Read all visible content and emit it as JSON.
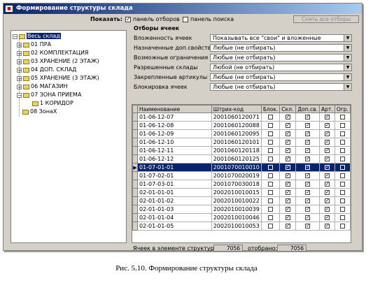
{
  "window": {
    "title": "Формирование структуры склада",
    "app_icon": "app-icon"
  },
  "toolbar": {
    "show_label": "Показать:",
    "filters_panel": {
      "label": "панель отборов",
      "checked": true
    },
    "search_panel": {
      "label": "панель поиска",
      "checked": false
    },
    "reset_button": "Снять все отборы"
  },
  "tree": {
    "root": "Весь склад",
    "items": [
      "01 ПРА",
      "02 КОМПЛЕКТАЦИЯ",
      "03 ХРАНЕНИЕ (2 ЭТАЖ)",
      "04 ДОП. СКЛАД",
      "05 ХРАНЕНИЕ (3 ЭТАЖ)",
      "06 МАГАЗИН",
      "07 ЗОНА ПРИЕМА"
    ],
    "subitem": "1 КОРИДОР",
    "last": "08 ЗонаХ"
  },
  "filters": {
    "title": "Отборы ячеек",
    "rows": [
      {
        "label": "Вложенность ячеек",
        "value": "Показывать все \"свои\" и вложенные"
      },
      {
        "label": "Назначенные доп.свойства",
        "value": "Любые (не отбирать)"
      },
      {
        "label": "Возможные ограничения",
        "value": "Любые (не отбирать)"
      },
      {
        "label": "Разрешенные склады",
        "value": "Любой (не отбирать)"
      },
      {
        "label": "Закрепленные артикулы",
        "value": "Любые (не отбирать)"
      },
      {
        "label": "Блокировка ячеек",
        "value": "Любые (не отбирать)"
      }
    ]
  },
  "grid": {
    "columns": [
      "Наименование",
      "Штрих-код",
      "Блок.",
      "Скл.",
      "Доп.св.",
      "Арт.",
      "Огр."
    ],
    "rows": [
      {
        "name": "01-06-12-07",
        "barcode": "2001060120071",
        "checks": [
          false,
          true,
          true,
          true,
          false
        ]
      },
      {
        "name": "01-06-12-08",
        "barcode": "2001060120088",
        "checks": [
          false,
          true,
          true,
          true,
          false
        ]
      },
      {
        "name": "01-06-12-09",
        "barcode": "2001060120095",
        "checks": [
          false,
          true,
          true,
          true,
          false
        ]
      },
      {
        "name": "01-06-12-10",
        "barcode": "2001060120101",
        "checks": [
          false,
          true,
          true,
          true,
          false
        ]
      },
      {
        "name": "01-06-12-11",
        "barcode": "2001060120118",
        "checks": [
          false,
          true,
          true,
          true,
          false
        ]
      },
      {
        "name": "01-06-12-12",
        "barcode": "2001060120125",
        "checks": [
          false,
          true,
          true,
          true,
          false
        ]
      },
      {
        "name": "01-07-01-01",
        "barcode": "2001070010010",
        "checks": [
          false,
          true,
          true,
          true,
          false
        ],
        "selected": true
      },
      {
        "name": "01-07-02-01",
        "barcode": "2001070020019",
        "checks": [
          false,
          true,
          true,
          true,
          false
        ]
      },
      {
        "name": "01-07-03-01",
        "barcode": "2001070030018",
        "checks": [
          false,
          true,
          true,
          true,
          false
        ]
      },
      {
        "name": "02-01-01-01",
        "barcode": "2002010010015",
        "checks": [
          false,
          true,
          true,
          true,
          false
        ]
      },
      {
        "name": "02-01-01-02",
        "barcode": "2002010010022",
        "checks": [
          false,
          true,
          true,
          true,
          false
        ]
      },
      {
        "name": "02-01-01-03",
        "barcode": "2002010010039",
        "checks": [
          false,
          true,
          true,
          true,
          false
        ]
      },
      {
        "name": "02-01-01-04",
        "barcode": "2002010010046",
        "checks": [
          false,
          true,
          true,
          true,
          false
        ]
      },
      {
        "name": "02-01-01-05",
        "barcode": "2002010010053",
        "checks": [
          false,
          true,
          true,
          true,
          false
        ]
      }
    ]
  },
  "status": {
    "cells_label": "Ячеек в элементе структуры:",
    "cells_value": "7056",
    "selected_label": "отобрано:",
    "selected_value": "7056"
  },
  "caption": "Рис. 5.10. Формирование структуры склада",
  "colors": {
    "title_start": "#0a246a",
    "title_end": "#a6caf0",
    "face": "#d4d0c8",
    "selection": "#0a246a"
  }
}
